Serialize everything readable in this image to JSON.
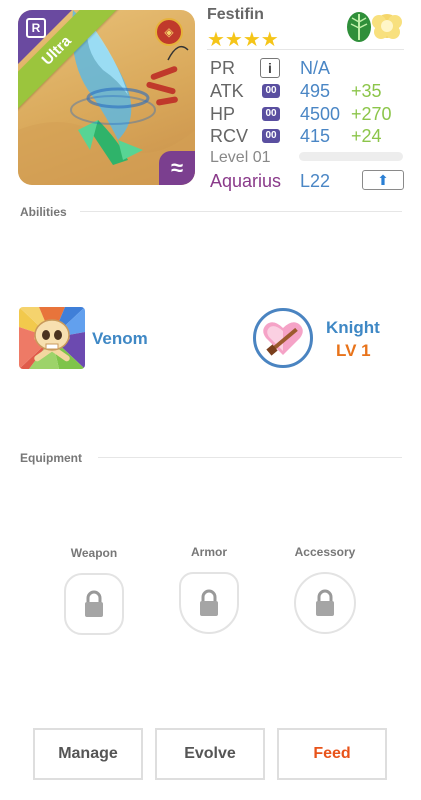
{
  "monster": {
    "name": "Festifin",
    "stars": "★★★★",
    "rarity": "Ultra",
    "rarity_badge": "R",
    "element_badge": "≈",
    "element_icons": [
      "leaf-icon",
      "cloud-icon"
    ]
  },
  "stats": {
    "pr": {
      "label": "PR",
      "info": "i",
      "value": "N/A"
    },
    "atk": {
      "label": "ATK",
      "badge": "00",
      "value": "495",
      "bonus": "+35"
    },
    "hp": {
      "label": "HP",
      "badge": "00",
      "value": "4500",
      "bonus": "+270"
    },
    "rcv": {
      "label": "RCV",
      "badge": "00",
      "value": "415",
      "bonus": "+24"
    },
    "level": {
      "label": "Level 01"
    },
    "sign": {
      "label": "Aquarius",
      "value": "L22"
    }
  },
  "abilities": {
    "title": "Abilities",
    "ability": {
      "name": "Venom"
    },
    "skill": {
      "name": "Knight",
      "level": "LV 1"
    }
  },
  "equipment": {
    "title": "Equipment",
    "slots": [
      {
        "label": "Weapon"
      },
      {
        "label": "Armor"
      },
      {
        "label": "Accessory"
      }
    ]
  },
  "actions": {
    "manage": "Manage",
    "evolve": "Evolve",
    "feed": "Feed"
  },
  "colors": {
    "accent_blue": "#3f88c5",
    "bonus_green": "#8cc54a",
    "feed_orange": "#e8531a",
    "sign_purple": "#8a3a8a"
  }
}
